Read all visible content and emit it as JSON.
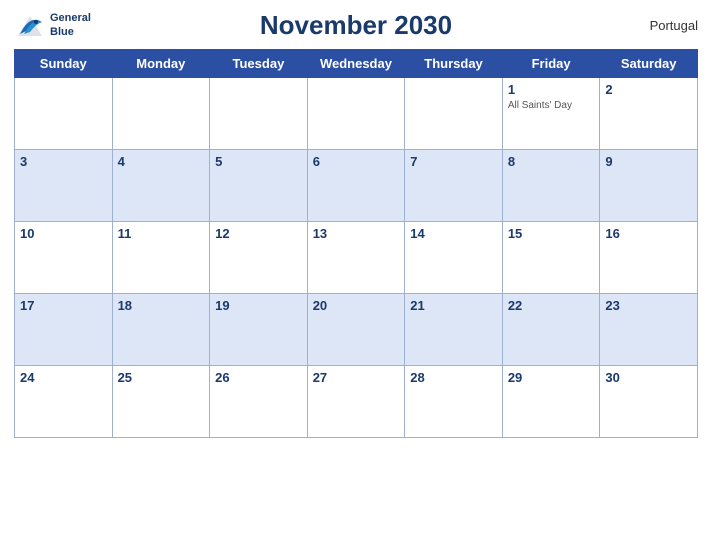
{
  "header": {
    "title": "November 2030",
    "country": "Portugal",
    "logo_line1": "General",
    "logo_line2": "Blue"
  },
  "weekdays": [
    "Sunday",
    "Monday",
    "Tuesday",
    "Wednesday",
    "Thursday",
    "Friday",
    "Saturday"
  ],
  "weeks": [
    [
      {
        "day": "",
        "holiday": ""
      },
      {
        "day": "",
        "holiday": ""
      },
      {
        "day": "",
        "holiday": ""
      },
      {
        "day": "",
        "holiday": ""
      },
      {
        "day": "",
        "holiday": ""
      },
      {
        "day": "1",
        "holiday": "All Saints' Day"
      },
      {
        "day": "2",
        "holiday": ""
      }
    ],
    [
      {
        "day": "3",
        "holiday": ""
      },
      {
        "day": "4",
        "holiday": ""
      },
      {
        "day": "5",
        "holiday": ""
      },
      {
        "day": "6",
        "holiday": ""
      },
      {
        "day": "7",
        "holiday": ""
      },
      {
        "day": "8",
        "holiday": ""
      },
      {
        "day": "9",
        "holiday": ""
      }
    ],
    [
      {
        "day": "10",
        "holiday": ""
      },
      {
        "day": "11",
        "holiday": ""
      },
      {
        "day": "12",
        "holiday": ""
      },
      {
        "day": "13",
        "holiday": ""
      },
      {
        "day": "14",
        "holiday": ""
      },
      {
        "day": "15",
        "holiday": ""
      },
      {
        "day": "16",
        "holiday": ""
      }
    ],
    [
      {
        "day": "17",
        "holiday": ""
      },
      {
        "day": "18",
        "holiday": ""
      },
      {
        "day": "19",
        "holiday": ""
      },
      {
        "day": "20",
        "holiday": ""
      },
      {
        "day": "21",
        "holiday": ""
      },
      {
        "day": "22",
        "holiday": ""
      },
      {
        "day": "23",
        "holiday": ""
      }
    ],
    [
      {
        "day": "24",
        "holiday": ""
      },
      {
        "day": "25",
        "holiday": ""
      },
      {
        "day": "26",
        "holiday": ""
      },
      {
        "day": "27",
        "holiday": ""
      },
      {
        "day": "28",
        "holiday": ""
      },
      {
        "day": "29",
        "holiday": ""
      },
      {
        "day": "30",
        "holiday": ""
      }
    ]
  ]
}
